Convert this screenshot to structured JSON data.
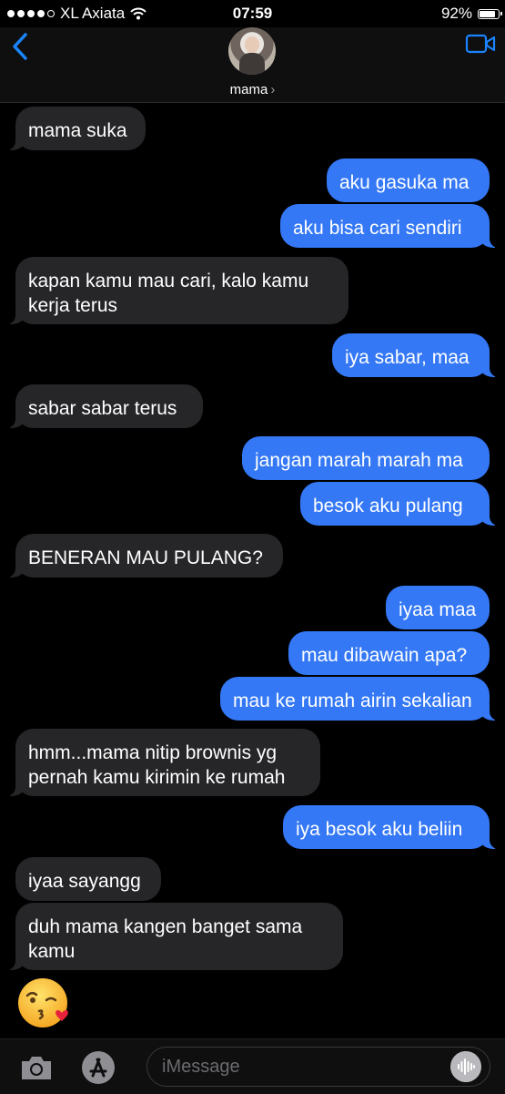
{
  "status": {
    "carrier": "XL Axiata",
    "time": "07:59",
    "battery_percent": "92%",
    "battery_level": 0.92,
    "signal_bars": 4
  },
  "header": {
    "contact_name": "mama",
    "chevron": "›"
  },
  "messages": [
    {
      "dir": "in",
      "text": "mama suka"
    },
    {
      "dir": "out",
      "text": "aku gasuka ma"
    },
    {
      "dir": "out",
      "text": "aku bisa cari sendiri"
    },
    {
      "dir": "in",
      "text": "kapan kamu mau cari, kalo kamu\nkerja terus"
    },
    {
      "dir": "out",
      "text": "iya sabar, maa"
    },
    {
      "dir": "in",
      "text": "sabar sabar terus"
    },
    {
      "dir": "out",
      "text": "jangan marah marah ma"
    },
    {
      "dir": "out",
      "text": "besok aku pulang"
    },
    {
      "dir": "in",
      "text": "BENERAN MAU PULANG?"
    },
    {
      "dir": "out",
      "text": "iyaa maa"
    },
    {
      "dir": "out",
      "text": "mau dibawain apa?"
    },
    {
      "dir": "out",
      "text": "mau ke rumah airin sekalian"
    },
    {
      "dir": "in",
      "text": "hmm...mama nitip brownis yg\npernah kamu kirimin ke rumah"
    },
    {
      "dir": "out",
      "text": "iya besok aku beliin"
    },
    {
      "dir": "in",
      "text": "iyaa sayangg"
    },
    {
      "dir": "in",
      "text": "duh mama kangen banget sama\nkamu"
    }
  ],
  "emoji_message": "kissing-heart-emoji",
  "input": {
    "placeholder": "iMessage"
  },
  "icons": [
    "back-chevron-icon",
    "video-camera-icon",
    "camera-icon",
    "app-store-icon",
    "audio-waveform-icon",
    "wifi-icon"
  ],
  "colors": {
    "outgoing": "#3478f6",
    "incoming": "#262629",
    "accent": "#1a84ff"
  }
}
